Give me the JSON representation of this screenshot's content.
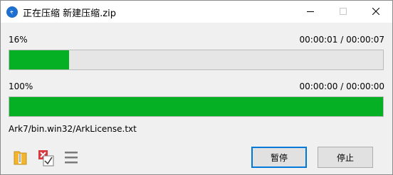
{
  "window": {
    "title": "正在压缩 新建压缩.zip"
  },
  "file_progress": {
    "percent_label": "16%",
    "percent": 16,
    "time_label": "00:00:01 / 00:00:07"
  },
  "total_progress": {
    "percent_label": "100%",
    "percent": 100,
    "time_label": "00:00:00 / 00:00:00"
  },
  "current_file": "Ark7/bin.win32/ArkLicense.txt",
  "buttons": {
    "pause_label": "暂停",
    "stop_label": "停止"
  },
  "colors": {
    "progress_fill": "#06b025",
    "progress_track": "#e6e6e6",
    "accent": "#0078d7"
  },
  "icons": {
    "app": "bandizip-icon",
    "open_folder": "folder-zip-icon",
    "options": "close-when-done-checkbox-icon",
    "menu": "hamburger-menu-icon"
  }
}
